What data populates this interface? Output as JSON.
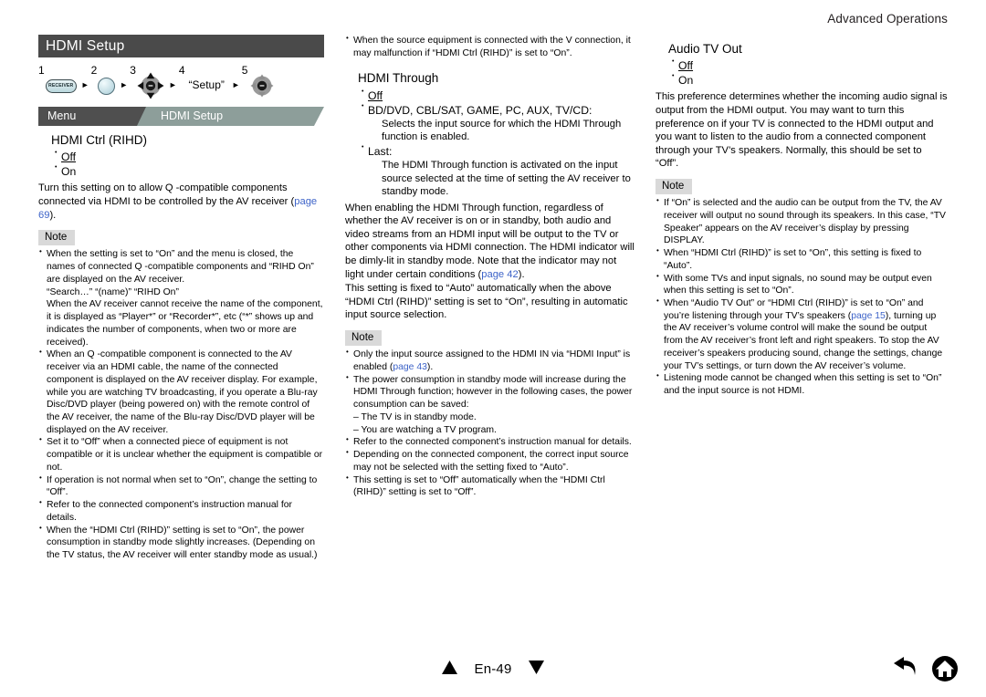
{
  "running_head": "Advanced Operations",
  "chapter_bar": {
    "title": "HDMI Setup"
  },
  "steps": {
    "items": [
      {
        "num": "1",
        "icon": "receiver-button-icon",
        "label": "RECEIVER"
      },
      {
        "num": "2",
        "icon": "round-button-icon",
        "label": ""
      },
      {
        "num": "3",
        "icon": "dpad-arrows-icon",
        "label": ""
      },
      {
        "num": "4",
        "icon": "text-label",
        "label": "“Setup”"
      },
      {
        "num": "5",
        "icon": "dpad-enter-icon",
        "label": ""
      }
    ],
    "separator": "►"
  },
  "breadcrumb": {
    "root": "Menu",
    "current": "HDMI Setup"
  },
  "col1": {
    "setting_title": "HDMI Ctrl (RIHD)",
    "options": [
      {
        "label": "Off",
        "underline": true
      },
      {
        "label": "On",
        "underline": false
      }
    ],
    "body": "Turn this setting on to allow Q         -compatible components connected via HDMI to be controlled by the AV receiver (",
    "body_ref": "page 69",
    "body_tail": ").",
    "note_label": "Note",
    "notes": [
      {
        "lines": [
          "When the setting is set to “On” and the menu is closed, the names of connected Q        -compatible components and “RIHD On” are displayed on the AV receiver.",
          "“Search…”      “(name)”      “RIHD On”",
          "When the AV receiver cannot receive the name of the component, it is displayed as “Player*” or “Recorder*”, etc (“*” shows up and indicates the number of components, when two or more are received)."
        ]
      },
      {
        "lines": [
          "When an Q        -compatible component is connected to the AV receiver via an HDMI cable, the name of the connected component is displayed on the AV receiver display. For example, while you are watching TV broadcasting, if you operate a Blu-ray Disc/DVD player (being powered on) with the remote control of the AV receiver, the name of the Blu-ray Disc/DVD player will be displayed on the AV receiver."
        ]
      },
      {
        "lines": [
          "Set it to “Off” when a connected piece of equipment is not compatible or it is unclear whether the equipment is compatible or not."
        ]
      },
      {
        "lines": [
          "If operation is not normal when set to “On”, change the setting to “Off”."
        ]
      },
      {
        "lines": [
          "Refer to the connected component’s instruction manual for details."
        ]
      },
      {
        "lines": [
          "When the “HDMI Ctrl (RIHD)” setting is set to “On”, the power consumption in standby mode slightly increases. (Depending on the TV status, the AV receiver will enter standby mode as usual.)"
        ]
      }
    ]
  },
  "col2": {
    "lead_note": "When the source equipment is connected with the V connection, it may malfunction if “HDMI Ctrl (RIHD)” is set to “On”.",
    "setting_title": "HDMI Through",
    "options": [
      {
        "label": "Off",
        "underline": true,
        "desc": ""
      },
      {
        "label": "BD/DVD, CBL/SAT, GAME, PC, AUX, TV/CD:",
        "underline": false,
        "desc": "Selects the input source for which the HDMI Through function is enabled."
      },
      {
        "label": "Last:",
        "underline": false,
        "desc": "The HDMI Through function is activated on the input source selected at the time of setting the AV receiver to standby mode."
      }
    ],
    "body1": "When enabling the HDMI Through function, regardless of whether the AV receiver is on or in standby, both audio and video streams from an HDMI input will be output to the TV or other components via HDMI connection. The HDMI indicator will be dimly-lit in standby mode. Note that the indicator may not light under certain conditions (",
    "body1_ref": "page 42",
    "body1_tail": ").",
    "body2": "This setting is fixed to “Auto” automatically when the above “HDMI Ctrl (RIHD)” setting is set to “On”, resulting in automatic input source selection.",
    "note_label": "Note",
    "notes": [
      {
        "text_before": "Only the input source assigned to the HDMI IN via “HDMI Input” is enabled (",
        "ref": "page 43",
        "text_after": ")."
      },
      {
        "text_before": "The power consumption in standby mode will increase during the HDMI Through function; however in the following cases, the power consumption can be saved:",
        "sublines": [
          "– The TV is in standby mode.",
          "– You are watching a TV program."
        ]
      },
      {
        "text_before": "Refer to the connected component’s instruction manual for details."
      },
      {
        "text_before": "Depending on the connected component, the correct input source may not be selected with the setting fixed to “Auto”."
      },
      {
        "text_before": "This setting is set to “Off” automatically when the “HDMI Ctrl (RIHD)” setting is set to “Off”."
      }
    ]
  },
  "col3": {
    "setting_title": "Audio TV Out",
    "options": [
      {
        "label": "Off",
        "underline": true
      },
      {
        "label": "On",
        "underline": false
      }
    ],
    "body": "This preference determines whether the incoming audio signal is output from the HDMI output. You may want to turn this preference on if your TV is connected to the HDMI output and you want to listen to the audio from a connected component through your TV’s speakers. Normally, this should be set to “Off”.",
    "note_label": "Note",
    "notes": [
      {
        "text_before": "If “On” is selected and the audio can be output from the TV, the AV receiver will output no sound through its speakers. In this case, “TV Speaker” appears on the AV receiver’s display by pressing DISPLAY."
      },
      {
        "text_before": "When “HDMI Ctrl (RIHD)” is set to “On”, this setting is fixed to “Auto”."
      },
      {
        "text_before": "With some TVs and input signals, no sound may be output even when this setting is set to “On”."
      },
      {
        "text_before": "When “Audio TV Out” or “HDMI Ctrl (RIHD)” is set to “On” and you’re listening through your TV’s speakers (",
        "ref": "page 15",
        "text_after": "), turning up the AV receiver’s volume control will make the sound be output from the AV receiver’s front left and right speakers. To stop the AV receiver’s speakers producing sound, change the settings, change your TV’s settings, or turn down the AV receiver’s volume."
      },
      {
        "text_before": "Listening mode cannot be changed when this setting is set to “On” and the input source is not HDMI."
      }
    ]
  },
  "footer": {
    "prev_icon": "triangle-up-icon",
    "page_label": "En-49",
    "next_icon": "triangle-down-icon",
    "back_icon": "back-arrow-icon",
    "home_icon": "home-icon"
  },
  "colors": {
    "chapter_bar_bg": "#4a4a4a",
    "breadcrumb_root_bg": "#4f4f4f",
    "breadcrumb_current_bg": "#8d9e9a",
    "note_tag_bg": "#d9d9d9",
    "link": "#3d63c8"
  }
}
